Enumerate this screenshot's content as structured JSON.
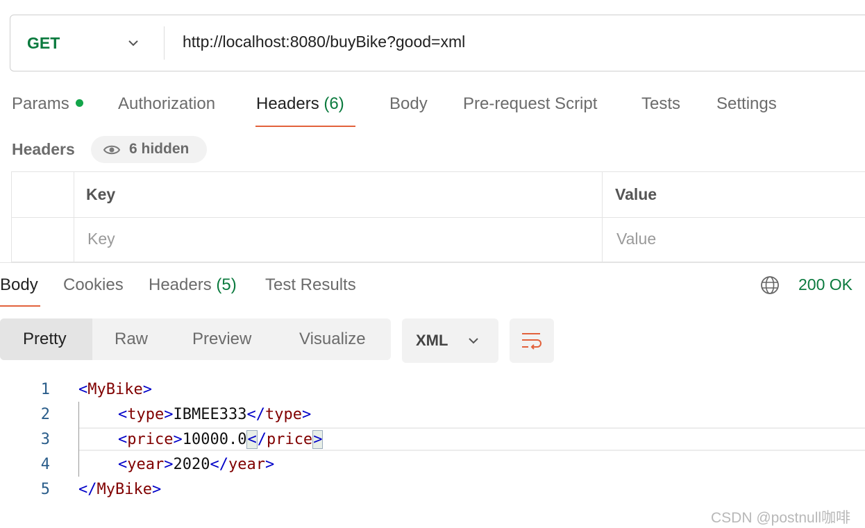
{
  "request": {
    "method": "GET",
    "url": "http://localhost:8080/buyBike?good=xml"
  },
  "request_tabs": {
    "params": "Params",
    "authorization": "Authorization",
    "headers": "Headers",
    "headers_count": "(6)",
    "body": "Body",
    "prerequest": "Pre-request Script",
    "tests": "Tests",
    "settings": "Settings",
    "active": "Headers"
  },
  "headers_section": {
    "label": "Headers",
    "hidden": "6 hidden",
    "columns": {
      "key": "Key",
      "value": "Value"
    },
    "placeholders": {
      "key": "Key",
      "value": "Value"
    }
  },
  "response_tabs": {
    "body": "Body",
    "cookies": "Cookies",
    "headers": "Headers",
    "headers_count": "(5)",
    "test_results": "Test Results",
    "active": "Body"
  },
  "status": "200 OK",
  "view_modes": {
    "pretty": "Pretty",
    "raw": "Raw",
    "preview": "Preview",
    "visualize": "Visualize",
    "active": "Pretty"
  },
  "format": "XML",
  "code": {
    "line_numbers": [
      "1",
      "2",
      "3",
      "4",
      "5"
    ],
    "root_tag": "MyBike",
    "type_tag": "type",
    "type_value": "IBMEE333",
    "price_tag": "price",
    "price_value": "10000.0",
    "year_tag": "year",
    "year_value": "2020"
  },
  "watermark": "CSDN @postnull咖啡",
  "colors": {
    "accent": "#e2613b",
    "success": "#0b7a3e",
    "xml_tag": "#800000",
    "xml_bracket": "#0000c8"
  }
}
